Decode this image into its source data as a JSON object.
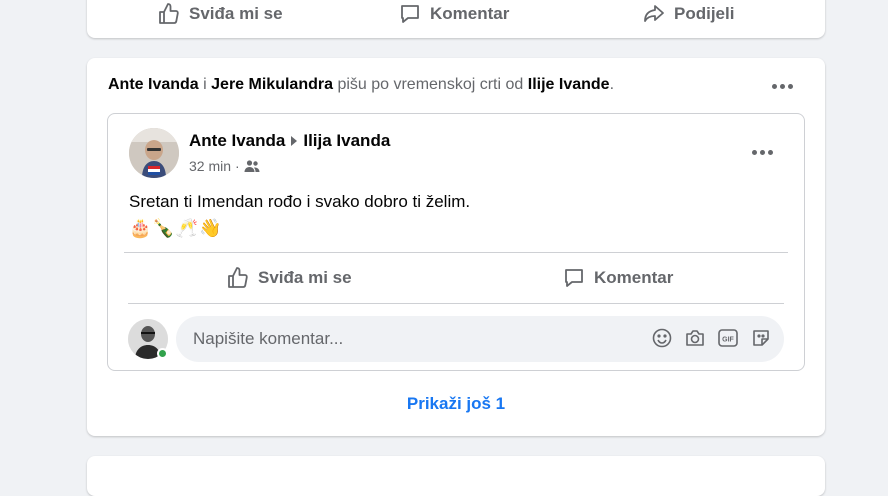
{
  "top_actions": {
    "like": "Sviđa mi se",
    "comment": "Komentar",
    "share": "Podijeli"
  },
  "post": {
    "header": {
      "author1": "Ante Ivanda",
      "and": "i",
      "author2": "Jere Mikulandra",
      "middle": "pišu po vremenskoj crti od",
      "target": "Ilije Ivande",
      "end": "."
    },
    "shared": {
      "from": "Ante Ivanda",
      "to": "Ilija Ivanda",
      "time": "32 min",
      "separator": "·",
      "audience_icon": "friends-icon",
      "text": "Sretan ti Imendan rođo i svako dobro ti želim.",
      "emojis": "🎂🍾🥂👋"
    },
    "actions": {
      "like": "Sviđa mi se",
      "comment": "Komentar"
    },
    "comment_input": {
      "placeholder": "Napišite komentar...",
      "gif_label": "GIF"
    },
    "show_more": "Prikaži još 1"
  },
  "colors": {
    "background": "#f0f2f5",
    "card": "#ffffff",
    "secondary_text": "#65676b",
    "link_blue": "#1877f2",
    "online": "#31a24c"
  }
}
